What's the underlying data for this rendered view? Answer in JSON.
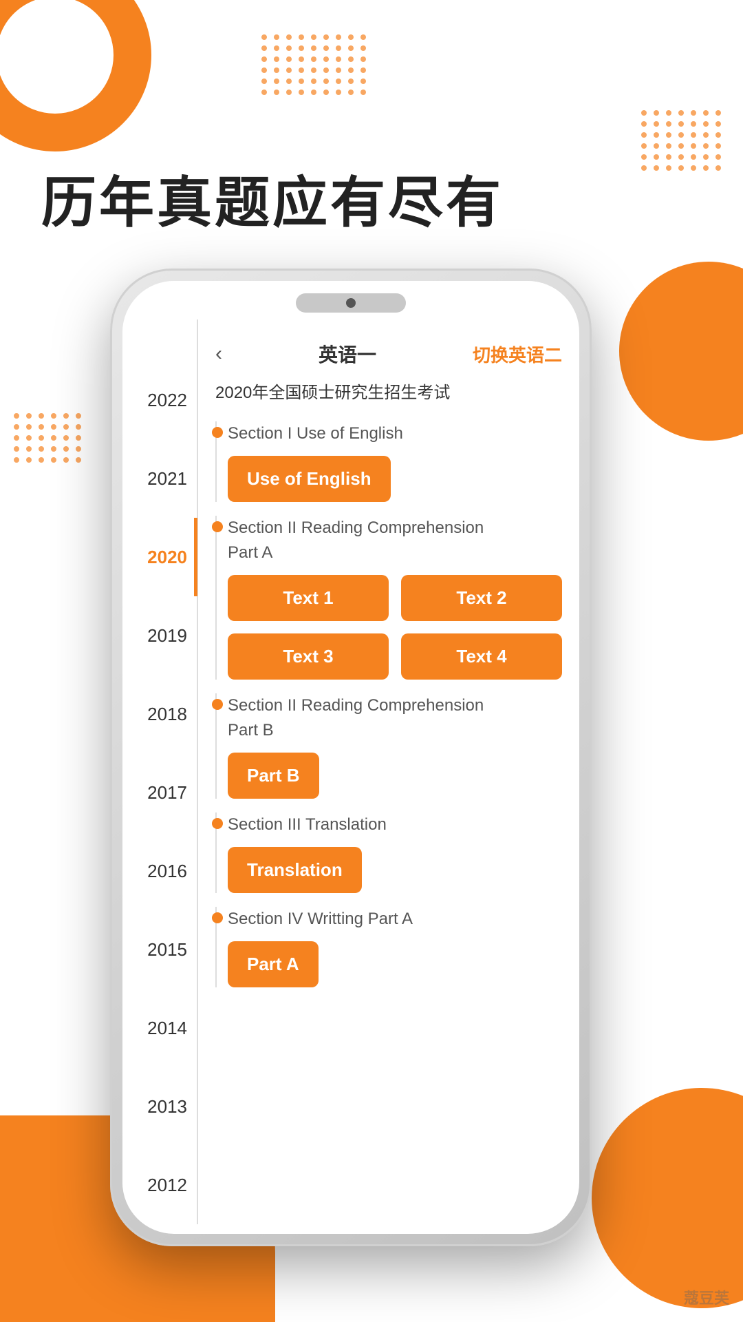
{
  "page": {
    "headline": "历年真题应有尽有",
    "watermark": "蔻豆芙"
  },
  "phone": {
    "header": {
      "back_icon": "‹",
      "title": "英语一",
      "switch_label": "切换英语二"
    },
    "exam_title": "2020年全国硕士研究生招生考试",
    "sections": [
      {
        "id": "section1",
        "label": "Section I Use of English",
        "buttons": [
          "Use of English"
        ]
      },
      {
        "id": "section2",
        "label": "Section II Reading Comprehension\nPart A",
        "buttons": [
          "Text 1",
          "Text 2",
          "Text 3",
          "Text 4"
        ]
      },
      {
        "id": "section3",
        "label": "Section II Reading Comprehension\nPart B",
        "buttons": [
          "Part B"
        ]
      },
      {
        "id": "section4",
        "label": "Section III Translation",
        "buttons": [
          "Translation"
        ]
      },
      {
        "id": "section5",
        "label": "Section IV Writting Part A",
        "buttons": [
          "Part A"
        ]
      }
    ],
    "years": [
      "2022",
      "2021",
      "2020",
      "2019",
      "2018",
      "2017",
      "2016",
      "2015",
      "2014",
      "2013",
      "2012"
    ],
    "active_year": "2020"
  },
  "colors": {
    "orange": "#F5821F",
    "text_dark": "#222222",
    "text_mid": "#555555",
    "bg_white": "#ffffff"
  }
}
